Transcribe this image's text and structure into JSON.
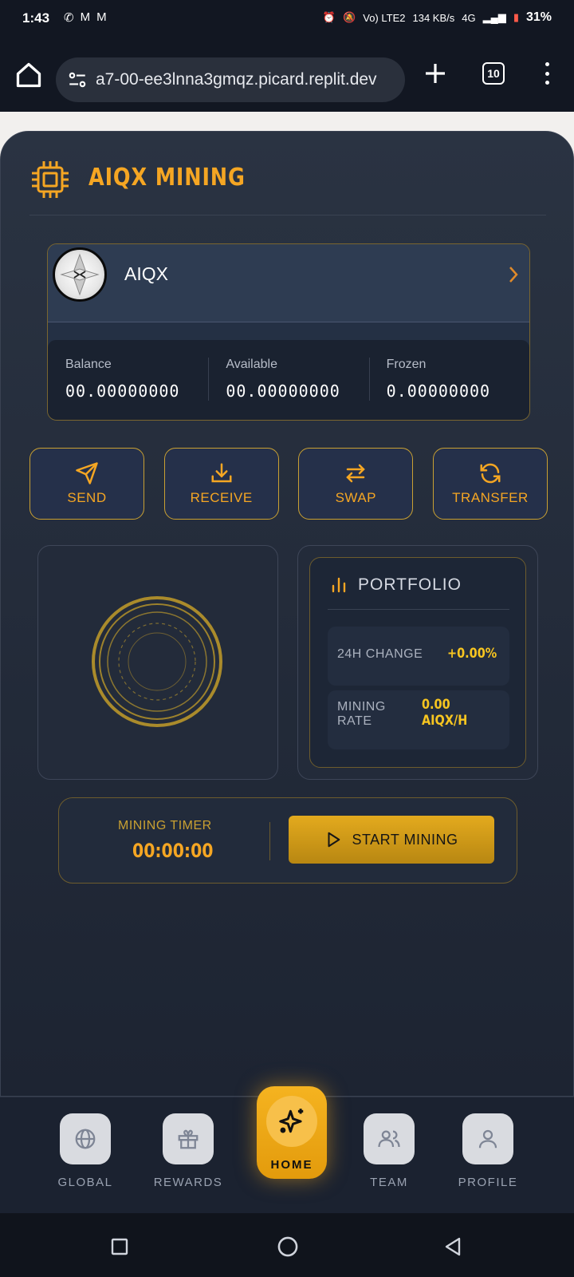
{
  "status_bar": {
    "time": "1:43",
    "network_label": "4G",
    "volte_label": "Vo) LTE2",
    "speed_label": "134 KB/s",
    "battery": "31%"
  },
  "browser": {
    "url": "a7-00-ee3lnna3gmqz.picard.replit.dev",
    "tab_count": "10"
  },
  "app": {
    "title": "AIQX MINING",
    "accent_color": "#f5a623"
  },
  "wallet": {
    "coin_name": "AIQX",
    "stats": [
      {
        "label": "Balance",
        "value": "00.00000000"
      },
      {
        "label": "Available",
        "value": "00.00000000"
      },
      {
        "label": "Frozen",
        "value": "0.00000000"
      }
    ]
  },
  "actions": [
    {
      "label": "SEND",
      "icon": "send-icon"
    },
    {
      "label": "RECEIVE",
      "icon": "download-icon"
    },
    {
      "label": "SWAP",
      "icon": "swap-icon"
    },
    {
      "label": "TRANSFER",
      "icon": "refresh-icon"
    }
  ],
  "portfolio": {
    "title": "PORTFOLIO",
    "change_label": "24H CHANGE",
    "change_value": "+0.00%",
    "rate_label_line1": "MINING",
    "rate_label_line2": "RATE",
    "rate_value_line1": "0.00",
    "rate_value_line2": "AIQX/H"
  },
  "timer": {
    "label": "MINING TIMER",
    "value": "00:00:00",
    "start_label": "START MINING"
  },
  "bottom_nav": [
    {
      "label": "GLOBAL",
      "icon": "globe-icon"
    },
    {
      "label": "REWARDS",
      "icon": "gift-icon"
    },
    {
      "label": "HOME",
      "icon": "sparkles-icon"
    },
    {
      "label": "TEAM",
      "icon": "users-icon"
    },
    {
      "label": "PROFILE",
      "icon": "user-icon"
    }
  ]
}
